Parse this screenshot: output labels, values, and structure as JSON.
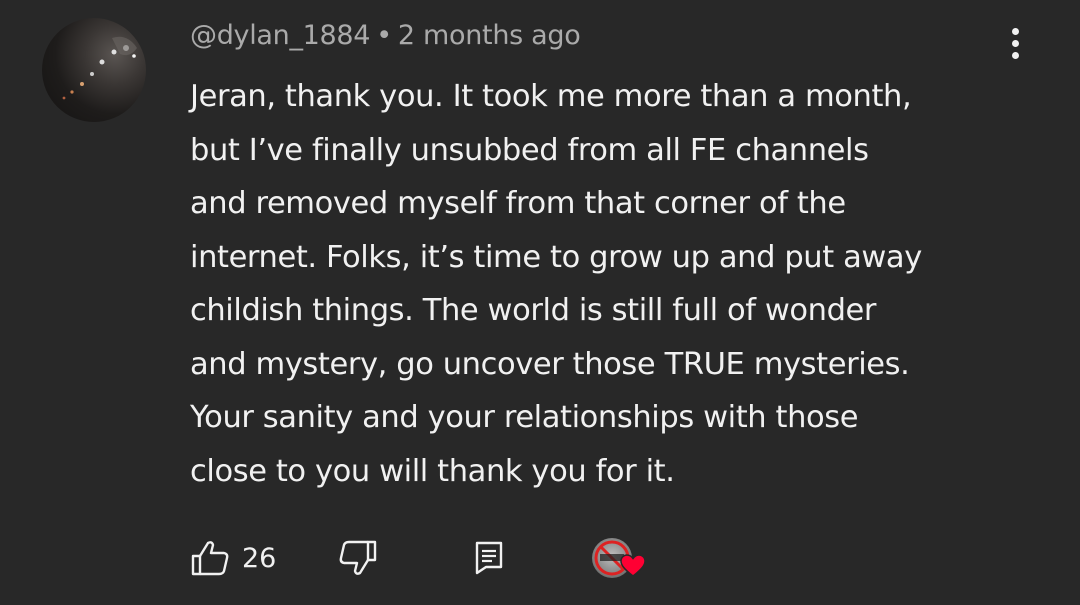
{
  "comment": {
    "author_handle": "@dylan_1884",
    "separator": "•",
    "timestamp": "2 months ago",
    "body_lines": [
      "Jeran, thank you. It took me more than a month,",
      "but I’ve finally unsubbed from all FE channels",
      "and removed myself from that corner of the",
      "internet. Folks, it’s time to grow up and put away",
      "childish things. The world is still full of wonder",
      "and mystery, go uncover those TRUE mysteries.",
      "Your sanity and your relationships with those",
      "close to you will thank you for it."
    ],
    "like_count": "26"
  },
  "icons": {
    "avatar": "user-avatar",
    "more": "more-vert-icon",
    "like": "thumb-up-icon",
    "dislike": "thumb-down-icon",
    "reply": "comment-icon",
    "creator_heart": "creator-heart-icon"
  },
  "colors": {
    "background": "#282828",
    "text_primary": "#f1f1f1",
    "text_secondary": "#aaaaaa",
    "heart": "#ff0033"
  }
}
